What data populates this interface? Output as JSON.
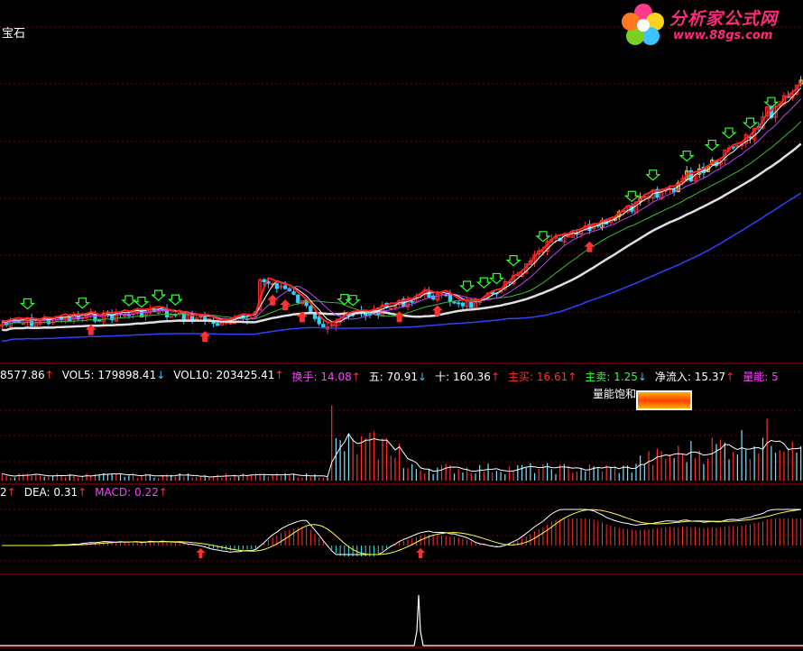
{
  "top_label": "宝石",
  "logo": {
    "name": "分析家公式网",
    "url": "www.88gs.com"
  },
  "saturation_label": "量能饱和",
  "volume_panel": {
    "items": [
      {
        "label": "",
        "value": "8577.86",
        "arrow": "↑",
        "color": "#ffffff",
        "arrow_color": "#ff3030"
      },
      {
        "label": "VOL5:",
        "value": "179898.41",
        "arrow": "↓",
        "color": "#ffffff",
        "arrow_color": "#40c0ff"
      },
      {
        "label": "VOL10:",
        "value": "203425.41",
        "arrow": "↑",
        "color": "#ffffff",
        "arrow_color": "#ff3030"
      },
      {
        "label": "换手:",
        "value": "14.08",
        "arrow": "↑",
        "color": "#ff40ff",
        "arrow_color": "#ff3030"
      },
      {
        "label": "五:",
        "value": "70.91",
        "arrow": "↓",
        "color": "#ffffff",
        "arrow_color": "#40c0ff"
      },
      {
        "label": "十:",
        "value": "160.36",
        "arrow": "↑",
        "color": "#ffffff",
        "arrow_color": "#ff3030"
      },
      {
        "label": "主买:",
        "value": "16.61",
        "arrow": "↑",
        "color": "#ff3030",
        "arrow_color": "#ff3030"
      },
      {
        "label": "主卖:",
        "value": "1.25",
        "arrow": "↓",
        "color": "#30ff30",
        "arrow_color": "#40c0ff"
      },
      {
        "label": "净流入:",
        "value": "15.37",
        "arrow": "↑",
        "color": "#ffffff",
        "arrow_color": "#ff3030"
      },
      {
        "label": "量能:",
        "value": "5",
        "arrow": "",
        "color": "#ff40ff",
        "arrow_color": "#ff3030"
      }
    ]
  },
  "macd_panel": {
    "items": [
      {
        "label": "",
        "value": "2",
        "arrow": "↑",
        "color": "#ffffff",
        "arrow_color": "#ff3030"
      },
      {
        "label": "DEA:",
        "value": "0.31",
        "arrow": "↑",
        "color": "#ffffff",
        "arrow_color": "#ff3030"
      },
      {
        "label": "MACD:",
        "value": "0.22",
        "arrow": "↑",
        "color": "#ff40ff",
        "arrow_color": "#ff3030"
      }
    ]
  },
  "colors": {
    "background": "#000000",
    "up": "#ff3030",
    "down": "#30d0ff",
    "grid": "#7a0000",
    "ma_white": "#e0e0e0",
    "ma_blue": "#3040ff",
    "ma_purple": "#c040ff",
    "ma_green": "#30c030",
    "buy_arrow": "#30ff30",
    "sell_arrow": "#ff3030"
  },
  "chart_data": {
    "type": "candlestick",
    "bars": 190,
    "signals": {
      "buy_arrow_color": "green",
      "sell_arrow_color": "red"
    }
  }
}
